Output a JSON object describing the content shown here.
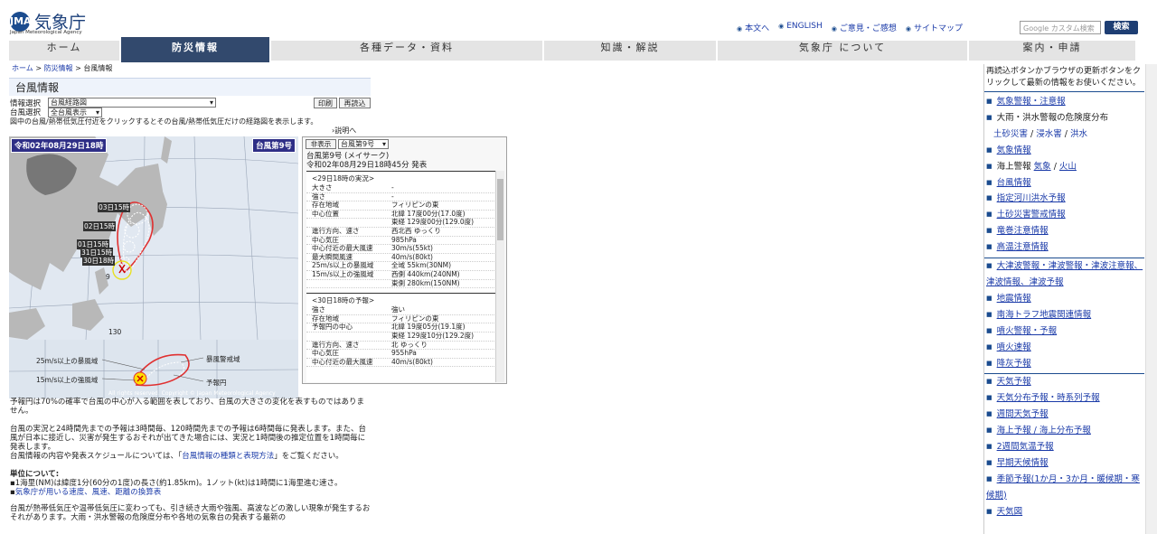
{
  "header": {
    "logo_jp": "気象庁",
    "logo_en": "Japan Meteorological Agency",
    "logo_mark": "JMA",
    "links": [
      "本文へ",
      "ENGLISH",
      "ご意見・ご感想",
      "サイトマップ"
    ],
    "search_placeholder": "Google カスタム検索",
    "search_button": "検索"
  },
  "nav": [
    "ホーム",
    "防災情報",
    "各種データ・資料",
    "知識・解説",
    "気象庁 について",
    "案内・申請"
  ],
  "breadcrumb": {
    "home": "ホーム",
    "bousai": "防災情報",
    "current": "台風情報",
    "sep": ">"
  },
  "title": "台風情報",
  "controls": {
    "info_label": "情報選択",
    "info_value": "台風経路図",
    "typhoon_label": "台風選択",
    "typhoon_value": "全台風表示",
    "print": "印刷",
    "reload": "再読込",
    "note": "図中の台風/熱帯低気圧付近をクリックするとその台風/熱帯低気圧だけの経路図を表示します。",
    "explain": "›説明へ"
  },
  "map": {
    "date": "令和02年08月29日18時",
    "typhoon": "台風第9号",
    "labels": [
      "03日15時",
      "02日15時",
      "01日15時",
      "31日15時",
      "30日18時"
    ],
    "number": "9",
    "legend_storm": "25m/s以上の暴風域",
    "legend_strong": "15m/s以上の強風域",
    "legend_warn": "暴風警戒域",
    "legend_circle": "予報円",
    "copyright": "All rights reserved. Copyright © Japan Meteorological Agency",
    "lon_tick": "130"
  },
  "panel": {
    "hide": "非表示",
    "select": "台風第9号",
    "name": "台風第9号 (メイサーク)",
    "issued": "令和02年08月29日18時45分 発表",
    "sec1": "<29日18時の実況>",
    "rows1": [
      [
        "大きさ",
        "-"
      ],
      [
        "強さ",
        "-"
      ],
      [
        "存在地域",
        "フィリピンの東"
      ],
      [
        "中心位置",
        "北緯 17度00分(17.0度)"
      ],
      [
        "",
        "東経 129度00分(129.0度)"
      ],
      [
        "進行方向、速さ",
        "西北西 ゆっくり"
      ],
      [
        "中心気圧",
        "985hPa"
      ],
      [
        "中心付近の最大風速",
        "30m/s(55kt)"
      ],
      [
        "最大瞬間風速",
        "40m/s(80kt)"
      ],
      [
        "25m/s以上の暴風域",
        "全域 55km(30NM)"
      ],
      [
        "15m/s以上の強風域",
        "西側 440km(240NM)"
      ],
      [
        "",
        "東側 280km(150NM)"
      ]
    ],
    "sec2": "<30日18時の予報>",
    "rows2": [
      [
        "強さ",
        "強い"
      ],
      [
        "存在地域",
        "フィリピンの東"
      ],
      [
        "予報円の中心",
        "北緯 19度05分(19.1度)"
      ],
      [
        "",
        "東経 129度10分(129.2度)"
      ],
      [
        "進行方向、速さ",
        "北 ゆっくり"
      ],
      [
        "中心気圧",
        "955hPa"
      ],
      [
        "中心付近の最大風速",
        "40m/s(80kt)"
      ]
    ]
  },
  "body": {
    "p1": "予報円は70%の確率で台風の中心が入る範囲を表しており、台風の大きさの変化を表すものではありません。",
    "p2": "台風の実況と24時間先までの予報は3時間毎、120時間先までの予報は6時間毎に発表します。また、台風が日本に接近し、災害が発生するおそれが出てきた場合には、実況と1時間後の推定位置を1時間毎に発表します。",
    "p3a": "台風情報の内容や発表スケジュールについては、「",
    "p3link": "台風情報の種類と表現方法",
    "p3b": "」をご覧ください。",
    "unit_title": "単位について:",
    "unit1": "1海里(NM)は緯度1分(60分の1度)の長さ(約1.85km)。1ノット(kt)は1時間に1海里進む速さ。",
    "unit2": "気象庁が用いる速度、風速、距離の換算表",
    "p4": "台風が熱帯低気圧や温帯低気圧に変わっても、引き続き大雨や強風、高波などの激しい現象が発生するおそれがあります。大雨・洪水警報の危険度分布や各地の気象台の発表する最新の"
  },
  "sidebar": {
    "intro": "再読込ボタンかブラウザの更新ボタンをクリックして最新の情報をお使いください。",
    "g1": [
      "気象警報・注意報"
    ],
    "kiken": "大雨・洪水警報の危険度分布",
    "kiken_subs": [
      "土砂災害",
      "浸水害",
      "洪水"
    ],
    "g1b": [
      "気象情報"
    ],
    "kaijo": "海上警報",
    "kaijo_subs": [
      "気象",
      "火山"
    ],
    "g1c": [
      "台風情報",
      "指定河川洪水予報",
      "土砂災害警戒情報",
      "竜巻注意情報",
      "高温注意情報"
    ],
    "g2": [
      "大津波警報・津波警報・津波注意報、津波情報、津波予報",
      "地震情報",
      "南海トラフ地震関連情報",
      "噴火警報・予報",
      "噴火速報",
      "降灰予報"
    ],
    "g3": [
      "天気予報",
      "天気分布予報・時系列予報",
      "週間天気予報",
      "海上予報 / 海上分布予報",
      "2週間気温予報",
      "早期天候情報",
      "季節予報(1か月・3か月・暖候期・寒候期)",
      "天気図"
    ]
  }
}
